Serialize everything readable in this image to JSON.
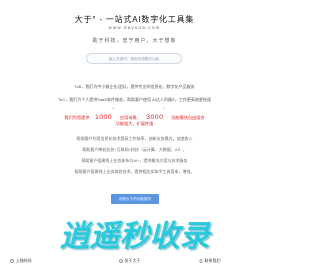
{
  "header": {
    "title": "大于° - 一站式AI数字化工具集",
    "domain": "www.dayuoa.com",
    "slogan": "助于科技，忠于用户，大于想象"
  },
  "search": {
    "placeholder": "输入关键词，搜索你想要的功能"
  },
  "intro": {
    "line1": "ToB，我们为中小微企业/团队，提供专业的信息化、数字化产品服务",
    "line2": "ToC，我们为个人提供SaaS软件服务，帮助客户使用 AI达人利器®，工作更高效更快速"
  },
  "promo": {
    "prefix": "我们为您提供",
    "count1": "1000",
    "count1_sup": "+",
    "mid": "应用场景，",
    "count2": "3000",
    "count2_sup": "+",
    "suffix": "功能模块自由组合",
    "sub": "功能强大，扩展性强"
  },
  "mission": {
    "line1": "帮助客户利用信息化技术提高工作效率，创新业务模式，创造收入",
    "line2": "帮助客户降低业务+互联网+科技（云计算，大数据，AI），",
    "line3": "帮助客户搭建线上业务体系与AI+，提供解决方案与技术服务",
    "line4": "帮助客户搭建线上业务体验技术，提供相应实体手工具用来，增效。"
  },
  "cta": {
    "label": "查看大于的功能服务"
  },
  "watermark": {
    "text": "逍遥秒收录"
  },
  "bottom_bar": {
    "items": [
      {
        "label": "上线时间"
      },
      {
        "label": "关于大于"
      },
      {
        "label": "联系我们"
      }
    ]
  },
  "colors": {
    "accent_red": "#e02020",
    "button_blue": "#5b95e2",
    "watermark_cyan": "#19c6dc"
  }
}
